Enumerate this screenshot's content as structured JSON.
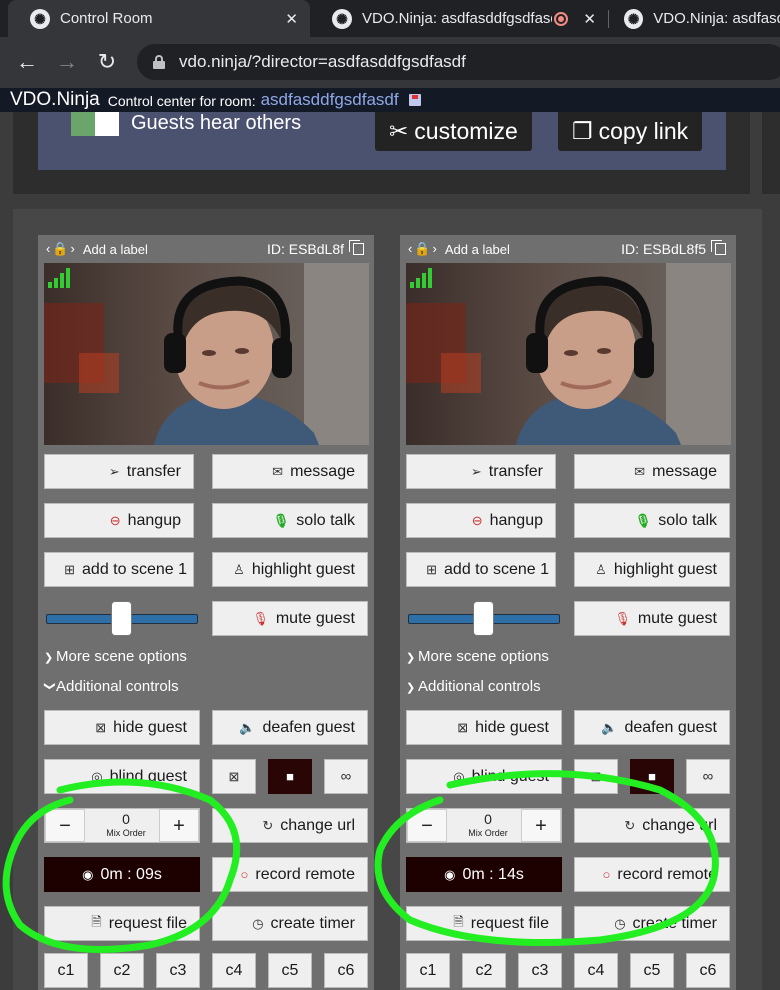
{
  "browser": {
    "tabs": [
      {
        "title": "Control Room",
        "close": "✕"
      },
      {
        "title": "VDO.Ninja: asdfasddfgsdfasd",
        "close": "✕"
      },
      {
        "title": "VDO.Ninja: asdfasd",
        "close": ""
      }
    ],
    "url_host": "vdo.ninja",
    "url_path": "/?director=asdfasddfgsdfasdf"
  },
  "app": {
    "brand": "VDO.Ninja",
    "subtitle": "Control center for room:",
    "room": "asdfasddfgsdfasdf",
    "guests_hear_others": "Guests hear others",
    "customize": "customize",
    "copy_link": "copy link"
  },
  "guests": [
    {
      "label": "Add a label",
      "id": "ID: ESBdL8f",
      "transfer": "transfer",
      "message": "message",
      "hangup": "hangup",
      "solo_talk": "solo talk",
      "add_to_scene": "add to scene 1",
      "highlight": "highlight guest",
      "mute": "mute guest",
      "more_scene": "More scene options",
      "additional": "Additional controls",
      "hide": "hide guest",
      "deafen": "deafen guest",
      "blind": "blind guest",
      "mix_value": "0",
      "mix_label": "Mix Order",
      "change_url": "change url",
      "timer": "0m : 09s",
      "record_remote": "record remote",
      "request_file": "request file",
      "create_timer": "create timer",
      "channels": [
        "c1",
        "c2",
        "c3",
        "c4",
        "c5",
        "c6"
      ]
    },
    {
      "label": "Add a label",
      "id": "ID: ESBdL8f5",
      "transfer": "transfer",
      "message": "message",
      "hangup": "hangup",
      "solo_talk": "solo talk",
      "add_to_scene": "add to scene 1",
      "highlight": "highlight guest",
      "mute": "mute guest",
      "more_scene": "More scene options",
      "additional": "Additional controls",
      "hide": "hide guest",
      "deafen": "deafen guest",
      "blind": "blind guest",
      "mix_value": "0",
      "mix_label": "Mix Order",
      "change_url": "change url",
      "timer": "0m : 14s",
      "record_remote": "record remote",
      "request_file": "request file",
      "create_timer": "create timer",
      "channels": [
        "c1",
        "c2",
        "c3",
        "c4",
        "c5",
        "c6"
      ]
    }
  ],
  "colors": {
    "accent_blue": "#8fa7e6",
    "annotation_green": "#22ee22",
    "timer_bg": "#1d0000"
  }
}
